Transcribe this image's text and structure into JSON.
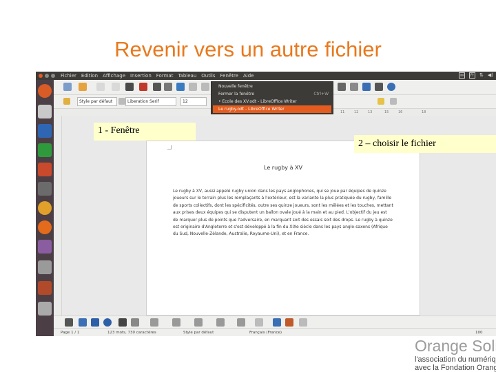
{
  "slide": {
    "title": "Revenir vers un autre fichier",
    "callouts": {
      "step1": "1 - Fenêtre",
      "step2": "2 –  choisir le fichier"
    }
  },
  "menubar": {
    "items": [
      "Fichier",
      "Edition",
      "Affichage",
      "Insertion",
      "Format",
      "Tableau",
      "Outils",
      "Fenêtre",
      "Aide"
    ],
    "tray": {
      "keyboard": "Fr"
    }
  },
  "window_menu": {
    "items": [
      {
        "label": "Nouvelle fenêtre",
        "shortcut": ""
      },
      {
        "label": "Fermer la fenêtre",
        "shortcut": "Ctrl+W"
      },
      {
        "label": "• Ecole des XV.odt - LibreOffice Writer",
        "shortcut": ""
      },
      {
        "label": "Le rugby.odt - LibreOffice Writer",
        "shortcut": "",
        "selected": true
      }
    ]
  },
  "formatting": {
    "paragraph_style": "Style par défaut",
    "font_name": "Liberation Serif",
    "font_size": "12"
  },
  "ruler": {
    "ticks": [
      "11",
      "12",
      "13",
      "15",
      "16",
      "18"
    ]
  },
  "document": {
    "title": "Le rugby à XV",
    "body": "Le rugby à XV, aussi appelé rugby union dans les pays anglophones, qui se joue par équipes de quinze joueurs sur le terrain plus les remplaçants à l'extérieur, est la variante la plus pratiquée du rugby, famille de sports collectifs, dont les spécificités, outre ses quinze joueurs, sont les mêlées et les touches, mettant aux prises deux équipes qui se disputent un ballon ovale joué à la main et au pied. L'objectif du jeu est de marquer plus de points que l'adversaire, en marquant soit des essais soit des drops. Le rugby à quinze est originaire d'Angleterre et s'est développé à la fin du XIXe siècle dans les pays anglo-saxons (Afrique du Sud, Nouvelle-Zélande, Australie, Royaume-Uni), et en France."
  },
  "statusbar": {
    "page": "Page 1 / 1",
    "words": "123 mots, 730 caractères",
    "style": "Style par défaut",
    "language": "Français (France)",
    "zoom": "100"
  },
  "brand": {
    "name": "Orange Solidarité",
    "line1": "l'association du numérique",
    "line2": "avec la Fondation Orange"
  },
  "colors": {
    "accent": "#e8791e",
    "menu_highlight": "#e45c1f",
    "callout_bg": "#ffffcc"
  }
}
